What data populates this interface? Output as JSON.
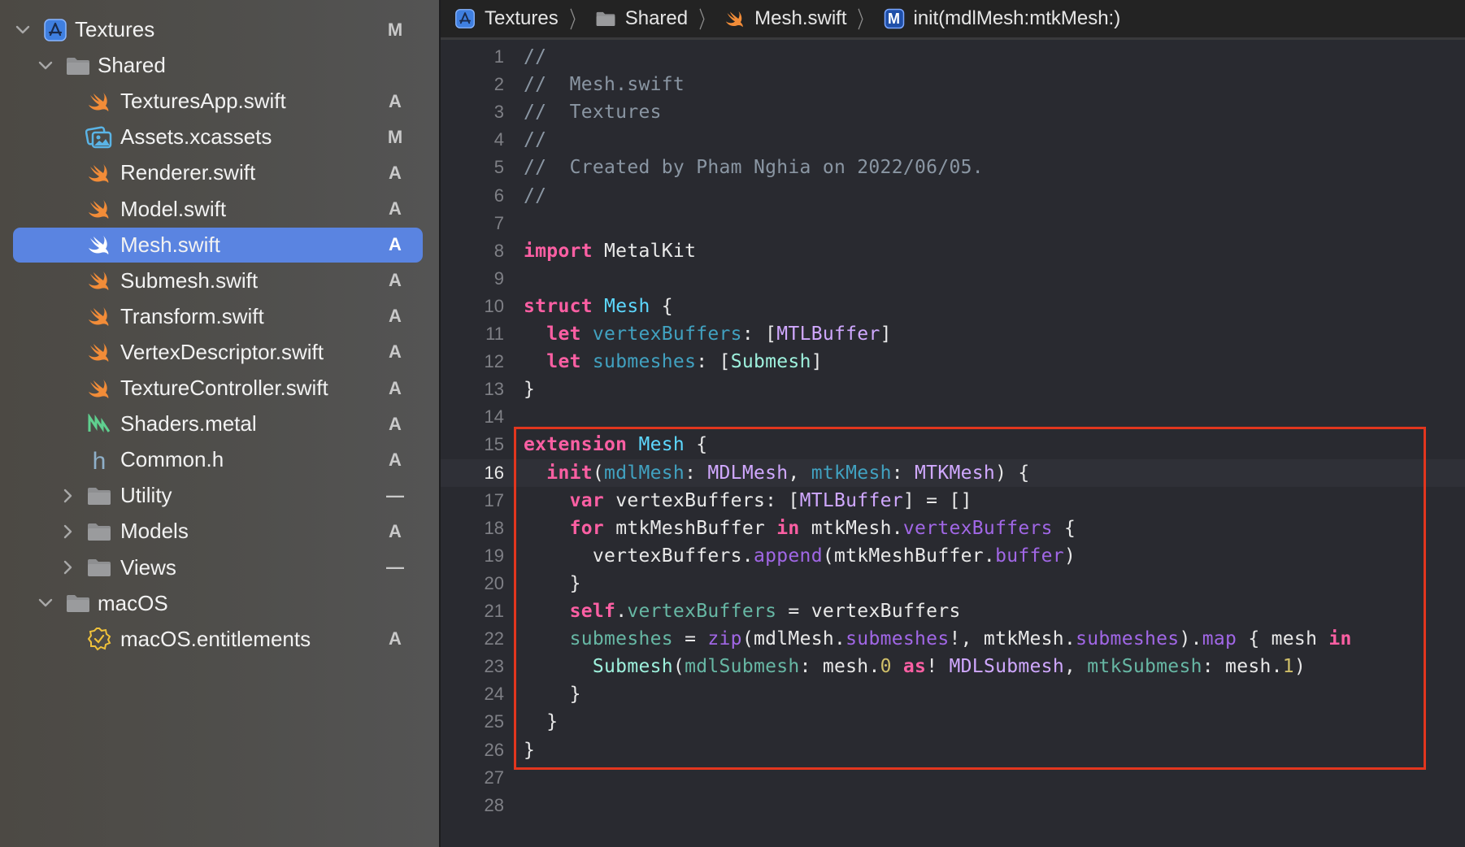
{
  "navigator": {
    "items": [
      {
        "label": "Textures",
        "kind": "project",
        "depth": 0,
        "expanded": true,
        "status": "M"
      },
      {
        "label": "Shared",
        "kind": "folder",
        "depth": 1,
        "expanded": true,
        "status": ""
      },
      {
        "label": "TexturesApp.swift",
        "kind": "swift",
        "depth": 2,
        "status": "A"
      },
      {
        "label": "Assets.xcassets",
        "kind": "assets",
        "depth": 2,
        "status": "M"
      },
      {
        "label": "Renderer.swift",
        "kind": "swift",
        "depth": 2,
        "status": "A"
      },
      {
        "label": "Model.swift",
        "kind": "swift",
        "depth": 2,
        "status": "A"
      },
      {
        "label": "Mesh.swift",
        "kind": "swift",
        "depth": 2,
        "status": "A",
        "selected": true
      },
      {
        "label": "Submesh.swift",
        "kind": "swift",
        "depth": 2,
        "status": "A"
      },
      {
        "label": "Transform.swift",
        "kind": "swift",
        "depth": 2,
        "status": "A"
      },
      {
        "label": "VertexDescriptor.swift",
        "kind": "swift",
        "depth": 2,
        "status": "A"
      },
      {
        "label": "TextureController.swift",
        "kind": "swift",
        "depth": 2,
        "status": "A"
      },
      {
        "label": "Shaders.metal",
        "kind": "metal",
        "depth": 2,
        "status": "A"
      },
      {
        "label": "Common.h",
        "kind": "header",
        "depth": 2,
        "status": "A"
      },
      {
        "label": "Utility",
        "kind": "folder",
        "depth": 2,
        "expanded": false,
        "status": "—"
      },
      {
        "label": "Models",
        "kind": "folder",
        "depth": 2,
        "expanded": false,
        "status": "A"
      },
      {
        "label": "Views",
        "kind": "folder",
        "depth": 2,
        "expanded": false,
        "status": "—"
      },
      {
        "label": "macOS",
        "kind": "folder",
        "depth": 1,
        "expanded": true,
        "status": ""
      },
      {
        "label": "macOS.entitlements",
        "kind": "entitlements",
        "depth": 2,
        "status": "A"
      }
    ]
  },
  "breadcrumb": [
    {
      "label": "Textures",
      "icon": "project-icon"
    },
    {
      "label": "Shared",
      "icon": "folder-icon"
    },
    {
      "label": "Mesh.swift",
      "icon": "swift-file-icon"
    },
    {
      "label": "init(mdlMesh:mtkMesh:)",
      "icon": "method-icon",
      "badge": "M"
    }
  ],
  "editor": {
    "current_line": 16,
    "highlight_range": [
      15,
      26
    ],
    "highlight_color": "#e2361e",
    "lines": [
      [
        [
          "t-comment",
          "//"
        ]
      ],
      [
        [
          "t-comment",
          "//  Mesh.swift"
        ]
      ],
      [
        [
          "t-comment",
          "//  Textures"
        ]
      ],
      [
        [
          "t-comment",
          "//"
        ]
      ],
      [
        [
          "t-comment",
          "//  Created by Pham Nghia on 2022/06/05."
        ]
      ],
      [
        [
          "t-comment",
          "//"
        ]
      ],
      [],
      [
        [
          "t-kw",
          "import"
        ],
        [
          "t-plain",
          " MetalKit"
        ]
      ],
      [],
      [
        [
          "t-kw",
          "struct"
        ],
        [
          "t-plain",
          " "
        ],
        [
          "t-type-decl",
          "Mesh"
        ],
        [
          "t-plain",
          " {"
        ]
      ],
      [
        [
          "t-plain",
          "  "
        ],
        [
          "t-kw",
          "let"
        ],
        [
          "t-plain",
          " "
        ],
        [
          "t-prop",
          "vertexBuffers"
        ],
        [
          "t-plain",
          ": ["
        ],
        [
          "t-type",
          "MTLBuffer"
        ],
        [
          "t-plain",
          "]"
        ]
      ],
      [
        [
          "t-plain",
          "  "
        ],
        [
          "t-kw",
          "let"
        ],
        [
          "t-plain",
          " "
        ],
        [
          "t-prop",
          "submeshes"
        ],
        [
          "t-plain",
          ": ["
        ],
        [
          "t-class-ref",
          "Submesh"
        ],
        [
          "t-plain",
          "]"
        ]
      ],
      [
        [
          "t-plain",
          "}"
        ]
      ],
      [],
      [
        [
          "t-kw",
          "extension"
        ],
        [
          "t-plain",
          " "
        ],
        [
          "t-type-decl",
          "Mesh"
        ],
        [
          "t-plain",
          " {"
        ]
      ],
      [
        [
          "t-plain",
          "  "
        ],
        [
          "t-kw",
          "init"
        ],
        [
          "t-plain",
          "("
        ],
        [
          "t-prop",
          "mdlMesh"
        ],
        [
          "t-plain",
          ": "
        ],
        [
          "t-type",
          "MDLMesh"
        ],
        [
          "t-plain",
          ", "
        ],
        [
          "t-prop",
          "mtkMesh"
        ],
        [
          "t-plain",
          ": "
        ],
        [
          "t-type",
          "MTKMesh"
        ],
        [
          "t-plain",
          ") {"
        ]
      ],
      [
        [
          "t-plain",
          "    "
        ],
        [
          "t-kw",
          "var"
        ],
        [
          "t-plain",
          " vertexBuffers: ["
        ],
        [
          "t-type",
          "MTLBuffer"
        ],
        [
          "t-plain",
          "] = []"
        ]
      ],
      [
        [
          "t-plain",
          "    "
        ],
        [
          "t-kw",
          "for"
        ],
        [
          "t-plain",
          " mtkMeshBuffer "
        ],
        [
          "t-kw",
          "in"
        ],
        [
          "t-plain",
          " mtkMesh."
        ],
        [
          "t-member",
          "vertexBuffers"
        ],
        [
          "t-plain",
          " {"
        ]
      ],
      [
        [
          "t-plain",
          "      vertexBuffers."
        ],
        [
          "t-member",
          "append"
        ],
        [
          "t-plain",
          "(mtkMeshBuffer."
        ],
        [
          "t-member",
          "buffer"
        ],
        [
          "t-plain",
          ")"
        ]
      ],
      [
        [
          "t-plain",
          "    }"
        ]
      ],
      [
        [
          "t-plain",
          "    "
        ],
        [
          "t-kw",
          "self"
        ],
        [
          "t-plain",
          "."
        ],
        [
          "t-local",
          "vertexBuffers"
        ],
        [
          "t-plain",
          " = vertexBuffers"
        ]
      ],
      [
        [
          "t-plain",
          "    "
        ],
        [
          "t-local",
          "submeshes"
        ],
        [
          "t-plain",
          " = "
        ],
        [
          "t-member",
          "zip"
        ],
        [
          "t-plain",
          "(mdlMesh."
        ],
        [
          "t-member",
          "submeshes"
        ],
        [
          "t-plain",
          "!, mtkMesh."
        ],
        [
          "t-member",
          "submeshes"
        ],
        [
          "t-plain",
          ")."
        ],
        [
          "t-member",
          "map"
        ],
        [
          "t-plain",
          " { mesh "
        ],
        [
          "t-kw",
          "in"
        ]
      ],
      [
        [
          "t-plain",
          "      "
        ],
        [
          "t-class-ref",
          "Submesh"
        ],
        [
          "t-plain",
          "("
        ],
        [
          "t-local",
          "mdlSubmesh"
        ],
        [
          "t-plain",
          ": mesh."
        ],
        [
          "t-num",
          "0"
        ],
        [
          "t-plain",
          " "
        ],
        [
          "t-kw",
          "as"
        ],
        [
          "t-plain",
          "! "
        ],
        [
          "t-type",
          "MDLSubmesh"
        ],
        [
          "t-plain",
          ", "
        ],
        [
          "t-local",
          "mtkSubmesh"
        ],
        [
          "t-plain",
          ": mesh."
        ],
        [
          "t-num",
          "1"
        ],
        [
          "t-plain",
          ")"
        ]
      ],
      [
        [
          "t-plain",
          "    }"
        ]
      ],
      [
        [
          "t-plain",
          "  }"
        ]
      ],
      [
        [
          "t-plain",
          "}"
        ]
      ],
      [],
      []
    ]
  }
}
